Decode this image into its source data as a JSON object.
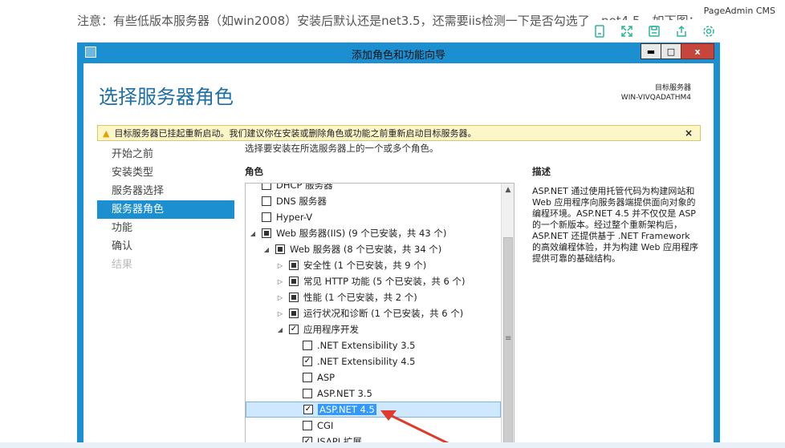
{
  "note": "注意：有些低版本服务器（如win2008）安装后默认还是net3.5，还需要iis检测一下是否勾选了...net4.5，如下图：",
  "brand": "PageAdmin CMS",
  "toolbar": [
    "page-icon",
    "expand-icon",
    "save-icon",
    "share-icon",
    "settings-icon"
  ],
  "window": {
    "title": "添加角色和功能向导",
    "min": "▬",
    "max": "□",
    "close": "x"
  },
  "header": {
    "title": "选择服务器角色",
    "server_label": "目标服务器",
    "server_name": "WIN-VIVQADATHM4"
  },
  "warning": {
    "text": "目标服务器已挂起重新启动。我们建议你在安装或删除角色或功能之前重新启动目标服务器。",
    "close": "×"
  },
  "nav": [
    {
      "label": "开始之前",
      "state": "normal"
    },
    {
      "label": "安装类型",
      "state": "normal"
    },
    {
      "label": "服务器选择",
      "state": "normal"
    },
    {
      "label": "服务器角色",
      "state": "active"
    },
    {
      "label": "功能",
      "state": "normal"
    },
    {
      "label": "确认",
      "state": "normal"
    },
    {
      "label": "结果",
      "state": "disabled"
    }
  ],
  "intro": "选择要安装在所选服务器上的一个或多个角色。",
  "roles_header": "角色",
  "desc_header": "描述",
  "description": "ASP.NET 通过使用托管代码为构建网站和 Web 应用程序向服务器端提供面向对象的编程环境。ASP.NET 4.5 并不仅仅是 ASP 的一个新版本。经过整个重新架构后，ASP.NET 还提供基于 .NET Framework 的高效编程体验，并为构建 Web 应用程序提供可靠的基础结构。",
  "tree": [
    {
      "label": "DHCP 服务器",
      "indent": 0,
      "check": "none",
      "expander": "",
      "selected": false
    },
    {
      "label": "DNS 服务器",
      "indent": 0,
      "check": "none",
      "expander": "",
      "selected": false
    },
    {
      "label": "Hyper-V",
      "indent": 0,
      "check": "none",
      "expander": "",
      "selected": false
    },
    {
      "label": "Web 服务器(IIS) (9 个已安装，共 43 个)",
      "indent": 0,
      "check": "part",
      "expander": "◢",
      "selected": false
    },
    {
      "label": "Web 服务器 (8 个已安装，共 34 个)",
      "indent": 1,
      "check": "part",
      "expander": "◢",
      "selected": false
    },
    {
      "label": "安全性 (1 个已安装，共 9 个)",
      "indent": 2,
      "check": "part",
      "expander": "▷",
      "selected": false
    },
    {
      "label": "常见 HTTP 功能 (5 个已安装，共 6 个)",
      "indent": 2,
      "check": "part",
      "expander": "▷",
      "selected": false
    },
    {
      "label": "性能 (1 个已安装，共 2 个)",
      "indent": 2,
      "check": "part",
      "expander": "▷",
      "selected": false
    },
    {
      "label": "运行状况和诊断 (1 个已安装，共 6 个)",
      "indent": 2,
      "check": "part",
      "expander": "▷",
      "selected": false
    },
    {
      "label": "应用程序开发",
      "indent": 2,
      "check": "checked",
      "expander": "◢",
      "selected": false
    },
    {
      "label": ".NET Extensibility 3.5",
      "indent": 3,
      "check": "none",
      "expander": "",
      "selected": false
    },
    {
      "label": ".NET Extensibility 4.5",
      "indent": 3,
      "check": "checked",
      "expander": "",
      "selected": false
    },
    {
      "label": "ASP",
      "indent": 3,
      "check": "none",
      "expander": "",
      "selected": false
    },
    {
      "label": "ASP.NET 3.5",
      "indent": 3,
      "check": "none",
      "expander": "",
      "selected": false
    },
    {
      "label": "ASP.NET 4.5",
      "indent": 3,
      "check": "checked",
      "expander": "",
      "selected": true
    },
    {
      "label": "CGI",
      "indent": 3,
      "check": "none",
      "expander": "",
      "selected": false
    },
    {
      "label": "ISAPI 扩展",
      "indent": 3,
      "check": "checked",
      "expander": "",
      "selected": false
    }
  ],
  "scroll": {
    "up": "▲",
    "grip": "≡"
  },
  "colors": {
    "accent": "#1c8fd1",
    "arrow": "#e03a2f",
    "warning_bg": "#fdf6c9"
  }
}
